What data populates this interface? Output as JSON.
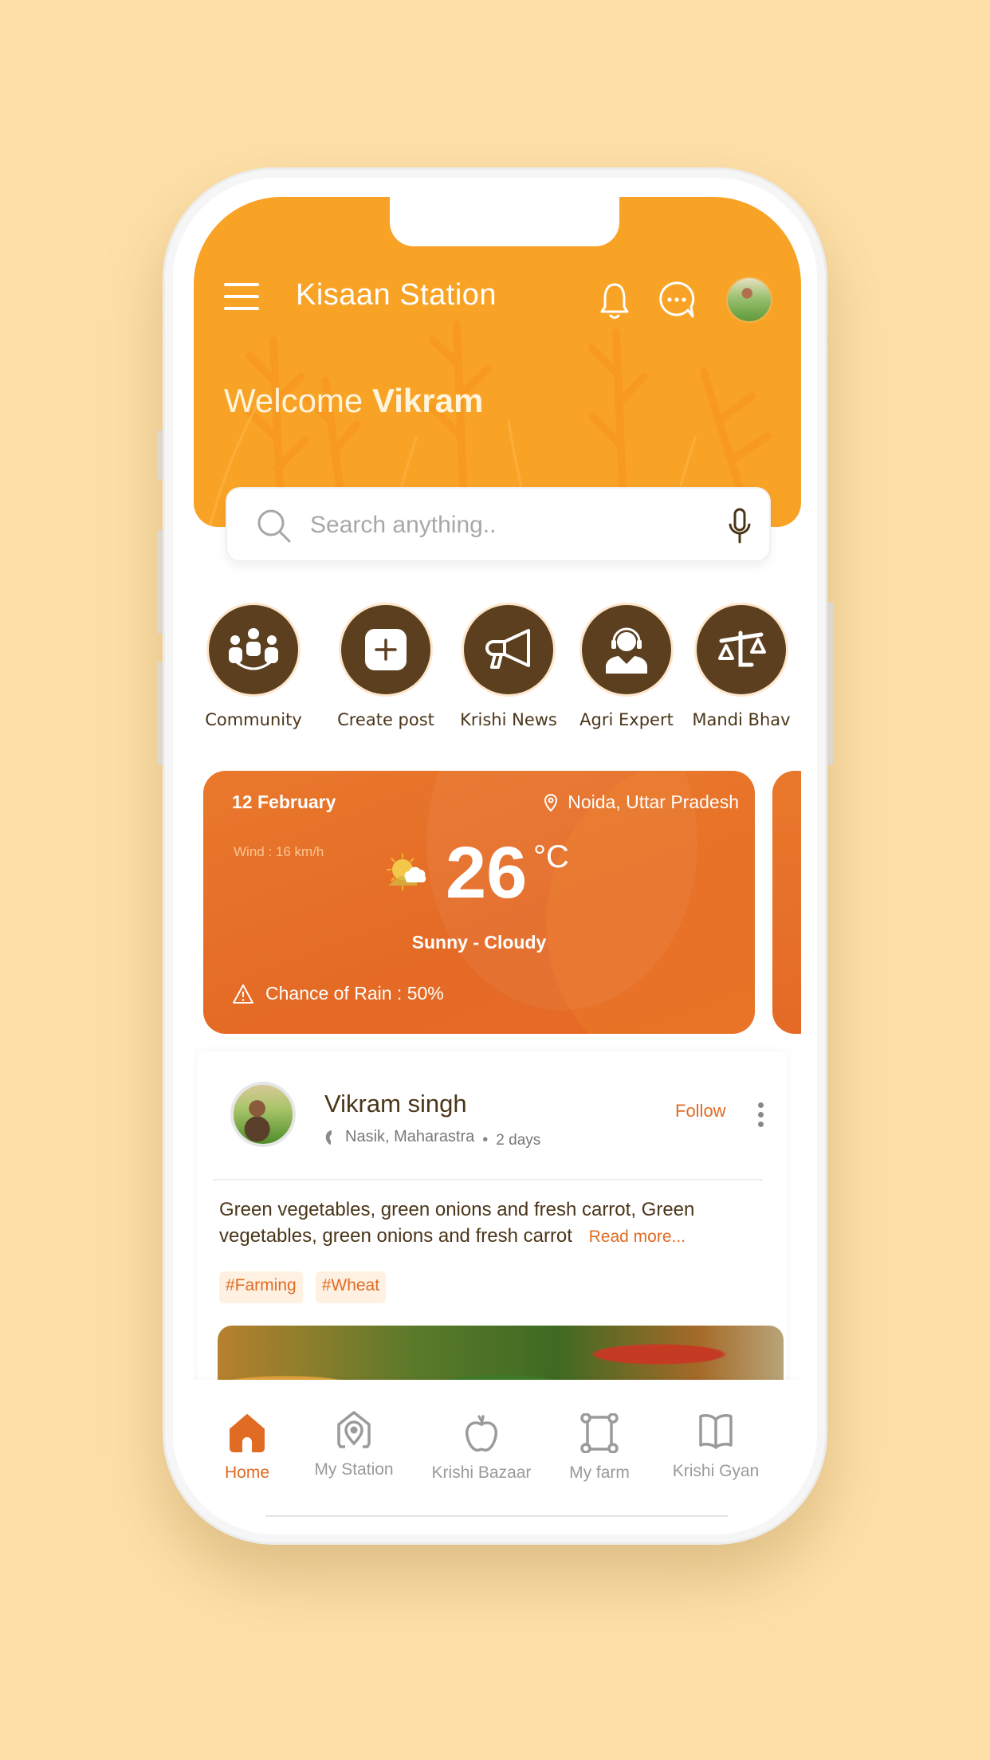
{
  "header": {
    "app_title": "Kisaan Station",
    "welcome_prefix": "Welcome",
    "user_first_name": "Vikram",
    "icons": [
      "menu-icon",
      "bell-icon",
      "chat-icon",
      "profile-avatar"
    ]
  },
  "search": {
    "placeholder": "Search anything..",
    "value": ""
  },
  "quick_actions": [
    {
      "label": "Community",
      "icon": "community-icon"
    },
    {
      "label": "Create post",
      "icon": "plus-square-icon"
    },
    {
      "label": "Krishi News",
      "icon": "megaphone-icon"
    },
    {
      "label": "Agri Expert",
      "icon": "headset-person-icon"
    },
    {
      "label": "Mandi Bhav",
      "icon": "scale-icon"
    }
  ],
  "weather": {
    "date": "12 February",
    "location": "Noida, Uttar Pradesh",
    "wind": "Wind : 16 km/h",
    "temperature": "26",
    "unit": "°C",
    "condition": "Sunny - Cloudy",
    "rain_chance": "Chance of Rain : 50%"
  },
  "post": {
    "author": "Vikram singh",
    "location": "Nasik, Maharastra",
    "time": "2 days",
    "follow_label": "Follow",
    "text": "Green vegetables, green onions and fresh carrot, Green vegetables, green onions and fresh carrot",
    "read_more": "Read more...",
    "tags": [
      "#Farming",
      "#Wheat"
    ]
  },
  "bottom_nav": [
    {
      "label": "Home",
      "icon": "home-icon",
      "active": true
    },
    {
      "label": "My Station",
      "icon": "station-icon",
      "active": false
    },
    {
      "label": "Krishi Bazaar",
      "icon": "apple-icon",
      "active": false
    },
    {
      "label": "My farm",
      "icon": "farm-boundary-icon",
      "active": false
    },
    {
      "label": "Krishi Gyan",
      "icon": "book-icon",
      "active": false
    }
  ],
  "colors": {
    "header_bg": "#f9a326",
    "weather_card": "#e46a26",
    "accent": "#e06b23",
    "brown": "#5b3f1f",
    "page_bg": "#fde0a8"
  }
}
